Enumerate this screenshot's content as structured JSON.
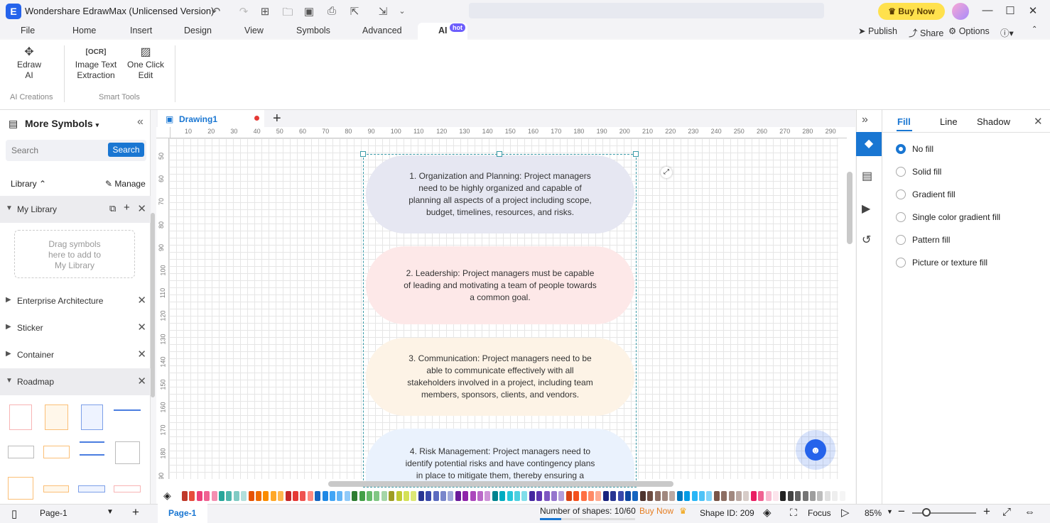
{
  "app": {
    "title": "Wondershare EdrawMax (Unlicensed Version)",
    "buy_now": "Buy Now"
  },
  "menu": {
    "items": [
      "File",
      "Home",
      "Insert",
      "Design",
      "View",
      "Symbols",
      "Advanced"
    ],
    "ai": "AI",
    "hot": "hot",
    "publish": "Publish",
    "share": "Share",
    "options": "Options"
  },
  "ribbon": {
    "edraw_ai": [
      "Edraw",
      "AI"
    ],
    "image_text": [
      "Image Text",
      "Extraction"
    ],
    "one_click": [
      "One Click",
      "Edit"
    ],
    "group_ai": "AI Creations",
    "group_smart": "Smart Tools"
  },
  "left": {
    "title": "More Symbols",
    "search_placeholder": "Search",
    "search_btn": "Search",
    "library": "Library",
    "manage": "Manage",
    "my_library": "My Library",
    "drag_hint": [
      "Drag symbols",
      "here to add to",
      "My Library"
    ],
    "sections": [
      "Enterprise Architecture",
      "Sticker",
      "Container",
      "Roadmap"
    ]
  },
  "doc": {
    "tab": "Drawing1"
  },
  "ruler": {
    "h": [
      "10",
      "20",
      "30",
      "40",
      "50",
      "60",
      "70",
      "80",
      "90",
      "100",
      "110",
      "120",
      "130",
      "140",
      "150",
      "160",
      "170",
      "180",
      "190",
      "200",
      "210",
      "220",
      "230",
      "240",
      "250",
      "260",
      "270",
      "280",
      "290"
    ],
    "v": [
      "50",
      "60",
      "70",
      "80",
      "90",
      "100",
      "110",
      "120",
      "130",
      "140",
      "150",
      "160",
      "170",
      "180",
      "90"
    ]
  },
  "shapes": [
    {
      "text": "1. Organization and Planning: Project managers need to be highly organized and capable of planning all aspects of a project including scope, budget, timelines, resources, and risks.",
      "color": "#e6e7f2"
    },
    {
      "text": "2. Leadership: Project managers must be capable of leading and motivating a team of people towards a common goal.",
      "color": "#fde8e8"
    },
    {
      "text": "3. Communication: Project managers need to be able to communicate effectively with all stakeholders involved in a project, including team members, sponsors, clients, and vendors.",
      "color": "#fdf3e6"
    },
    {
      "text": "4. Risk Management: Project managers need to identify potential risks and have contingency plans in place to mitigate them, thereby ensuring a",
      "color": "#eaf2fd"
    }
  ],
  "right": {
    "tabs": [
      "Fill",
      "Line",
      "Shadow"
    ],
    "options": [
      "No fill",
      "Solid fill",
      "Gradient fill",
      "Single color gradient fill",
      "Pattern fill",
      "Picture or texture fill"
    ],
    "selected": 0
  },
  "status": {
    "page_select": "Page-1",
    "page_tab": "Page-1",
    "shapes": "Number of shapes: 10/60",
    "buy_now": "Buy Now",
    "shape_id": "Shape ID: 209",
    "focus": "Focus",
    "zoom": "85%"
  },
  "palette": [
    "#c0392b",
    "#e74c3c",
    "#ec407a",
    "#f06292",
    "#f48fb1",
    "#26a69a",
    "#4db6ac",
    "#80cbc4",
    "#b2dfdb",
    "#e65100",
    "#ef6c00",
    "#fb8c00",
    "#ffa726",
    "#ffb74d",
    "#c62828",
    "#e53935",
    "#ef5350",
    "#ff8a80",
    "#1565c0",
    "#1e88e5",
    "#42a5f5",
    "#64b5f6",
    "#90caf9",
    "#2e7d32",
    "#43a047",
    "#66bb6a",
    "#81c784",
    "#a5d6a7",
    "#9e9d24",
    "#c0ca33",
    "#d4e157",
    "#dce775",
    "#283593",
    "#3949ab",
    "#5c6bc0",
    "#7986cb",
    "#9fa8da",
    "#6a1b9a",
    "#8e24aa",
    "#ab47bc",
    "#ba68c8",
    "#ce93d8",
    "#00838f",
    "#00acc1",
    "#26c6da",
    "#4dd0e1",
    "#80deea",
    "#4527a0",
    "#5e35b1",
    "#7e57c2",
    "#9575cd",
    "#b39ddb",
    "#d84315",
    "#f4511e",
    "#ff7043",
    "#ff8a65",
    "#ffab91",
    "#1a237e",
    "#283593",
    "#3949ab",
    "#0d47a1",
    "#1565c0",
    "#4e342e",
    "#6d4c41",
    "#8d6e63",
    "#a1887f",
    "#bcaaa4",
    "#0277bd",
    "#039be5",
    "#29b6f6",
    "#4fc3f7",
    "#81d4fa",
    "#795548",
    "#8d6e63",
    "#a1887f",
    "#bcaaa4",
    "#d7ccc8",
    "#e91e63",
    "#f06292",
    "#f8bbd0",
    "#fce4ec",
    "#212121",
    "#424242",
    "#616161",
    "#757575",
    "#9e9e9e",
    "#bdbdbd",
    "#e0e0e0",
    "#eeeeee",
    "#f5f5f5"
  ]
}
